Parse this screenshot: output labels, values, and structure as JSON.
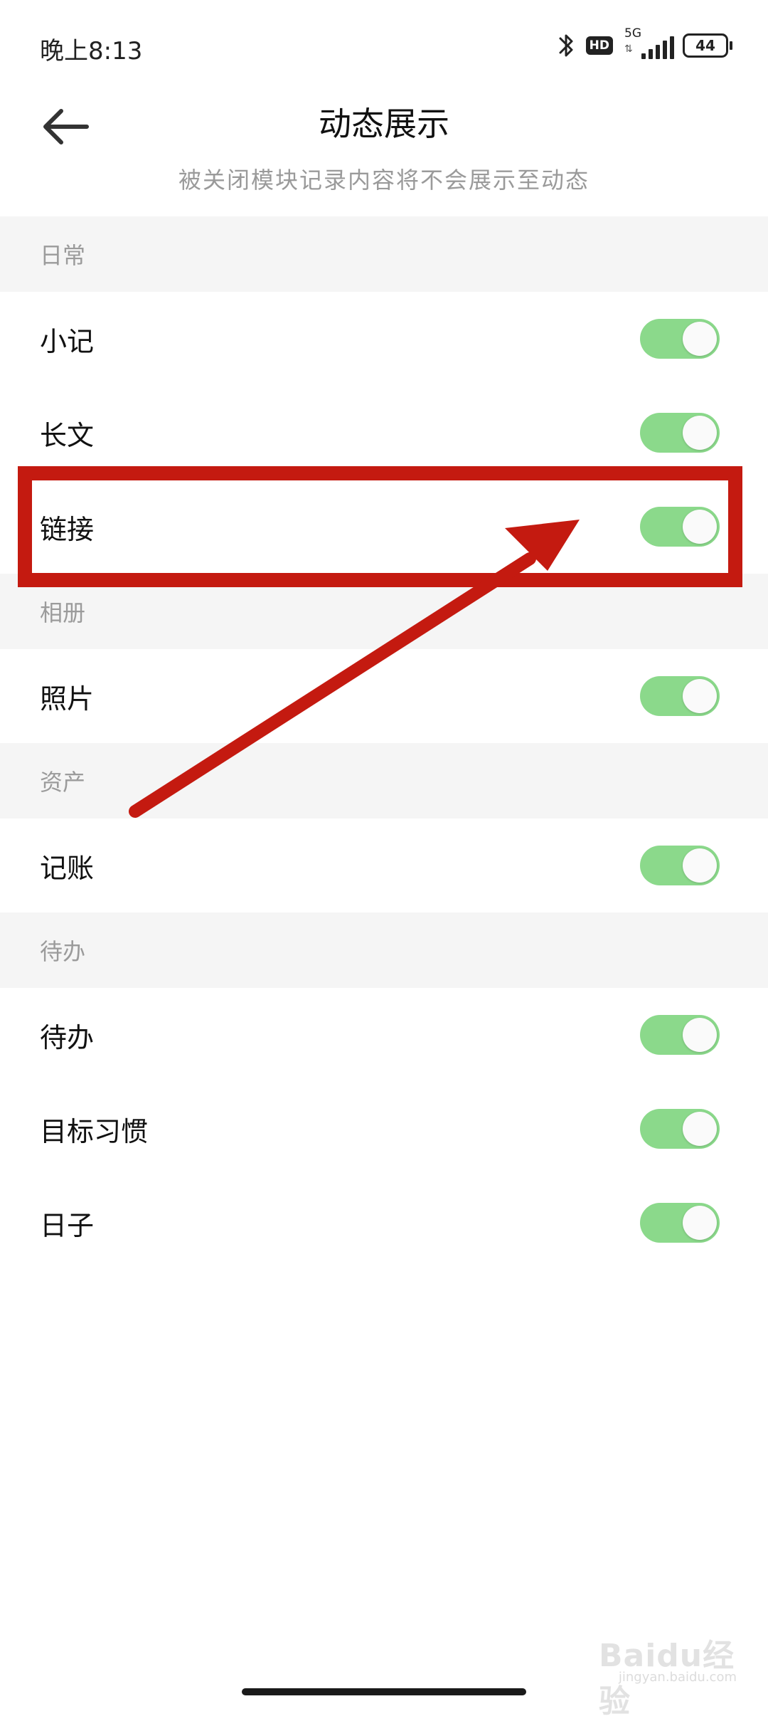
{
  "status_bar": {
    "time": "晚上8:13",
    "hd": "HD",
    "network": "5G",
    "battery": "44"
  },
  "header": {
    "title": "动态展示",
    "subtitle": "被关闭模块记录内容将不会展示至动态",
    "back_icon": "arrow-left-icon"
  },
  "sections": [
    {
      "title": "日常",
      "items": [
        {
          "label": "小记",
          "enabled": true
        },
        {
          "label": "长文",
          "enabled": true
        },
        {
          "label": "链接",
          "enabled": true
        }
      ]
    },
    {
      "title": "相册",
      "items": [
        {
          "label": "照片",
          "enabled": true
        }
      ]
    },
    {
      "title": "资产",
      "items": [
        {
          "label": "记账",
          "enabled": true
        }
      ]
    },
    {
      "title": "待办",
      "items": [
        {
          "label": "待办",
          "enabled": true
        },
        {
          "label": "目标习惯",
          "enabled": true
        },
        {
          "label": "日子",
          "enabled": true
        }
      ]
    }
  ],
  "colors": {
    "toggle_on": "#8bd98b",
    "annotation": "#c41a10",
    "section_bg": "#f5f5f5"
  },
  "watermark": {
    "main": "Baidu经验",
    "sub": "jingyan.baidu.com"
  }
}
